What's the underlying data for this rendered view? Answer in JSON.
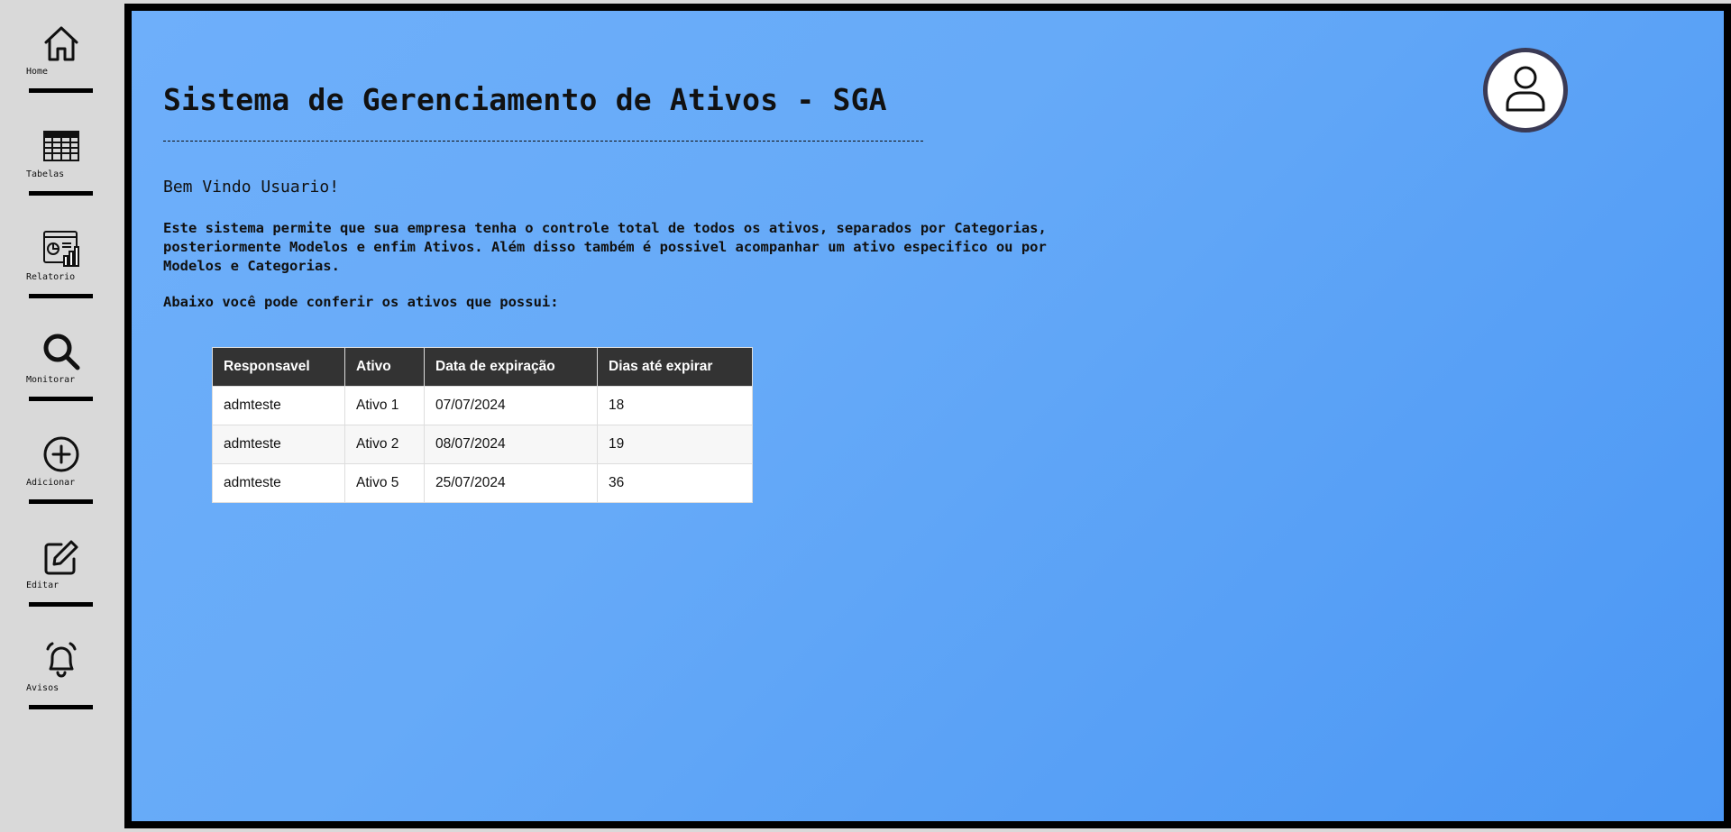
{
  "sidebar": {
    "items": [
      {
        "label": "Home",
        "icon": "home-icon"
      },
      {
        "label": "Tabelas",
        "icon": "table-icon"
      },
      {
        "label": "Relatorio",
        "icon": "report-icon"
      },
      {
        "label": "Monitorar",
        "icon": "search-icon"
      },
      {
        "label": "Adicionar",
        "icon": "add-circle-icon"
      },
      {
        "label": "Editar",
        "icon": "edit-icon"
      },
      {
        "label": "Avisos",
        "icon": "bell-icon"
      }
    ]
  },
  "header": {
    "title": "Sistema de Gerenciamento de Ativos - SGA",
    "avatar_icon": "user-icon"
  },
  "main": {
    "welcome": "Bem Vindo Usuario!",
    "intro": "Este sistema permite que sua empresa tenha o controle total de todos os ativos, separados por Categorias, posteriormente Modelos e enfim Ativos. Além disso também é possivel acompanhar um ativo especifico ou por Modelos e Categorias.",
    "owned_intro": "Abaixo você pode conferir os ativos que possui:"
  },
  "table": {
    "columns": [
      "Responsavel",
      "Ativo",
      "Data de expiração",
      "Dias até expirar"
    ],
    "rows": [
      [
        "admteste",
        "Ativo 1",
        "07/07/2024",
        "18"
      ],
      [
        "admteste",
        "Ativo 2",
        "08/07/2024",
        "19"
      ],
      [
        "admteste",
        "Ativo 5",
        "25/07/2024",
        "36"
      ]
    ]
  },
  "colors": {
    "background_gradient_start": "#6eaffa",
    "background_gradient_end": "#4b97f4",
    "sidebar": "#d9d9d9",
    "table_header": "#333333",
    "avatar_border": "#3a3a55"
  }
}
